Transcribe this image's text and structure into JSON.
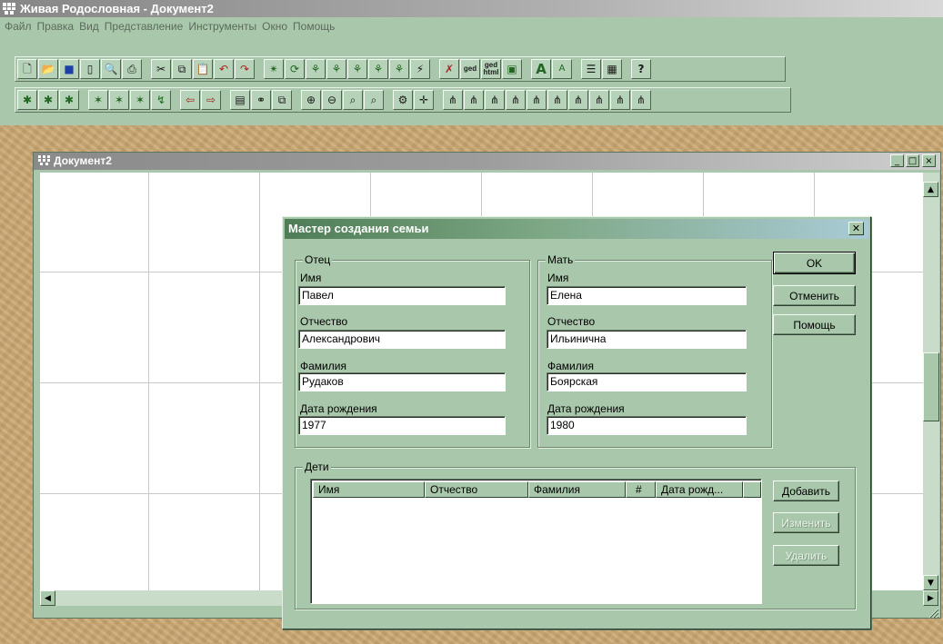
{
  "app": {
    "title": "Живая Родословная - Документ2",
    "menu": [
      "Файл",
      "Правка",
      "Вид",
      "Представление",
      "Инструменты",
      "Окно",
      "Помощь"
    ]
  },
  "document": {
    "title": "Документ2",
    "controls": {
      "minimize": "_",
      "maximize": "□",
      "close": "×"
    }
  },
  "dialog": {
    "title": "Мастер создания семьи",
    "father": {
      "legend": "Отец",
      "name_label": "Имя",
      "name": "Павел",
      "patronymic_label": "Отчество",
      "patronymic": "Александрович",
      "surname_label": "Фамилия",
      "surname": "Рудаков",
      "birth_label": "Дата рождения",
      "birth": "1977"
    },
    "mother": {
      "legend": "Мать",
      "name_label": "Имя",
      "name": "Елена",
      "patronymic_label": "Отчество",
      "patronymic": "Ильинична",
      "surname_label": "Фамилия",
      "surname": "Боярская",
      "birth_label": "Дата рождения",
      "birth": "1980"
    },
    "buttons": {
      "ok": "OK",
      "cancel": "Отменить",
      "help": "Помощь"
    },
    "children": {
      "legend": "Дети",
      "columns": [
        "Имя",
        "Отчество",
        "Фамилия",
        "#",
        "Дата рожд..."
      ],
      "rows": [],
      "add": "Добавить",
      "edit": "Изменить",
      "delete": "Удалить"
    }
  },
  "toolbar1_small_labels": {
    "ged": "ged",
    "ged_html_top": "ged",
    "ged_html_bottom": "html"
  }
}
